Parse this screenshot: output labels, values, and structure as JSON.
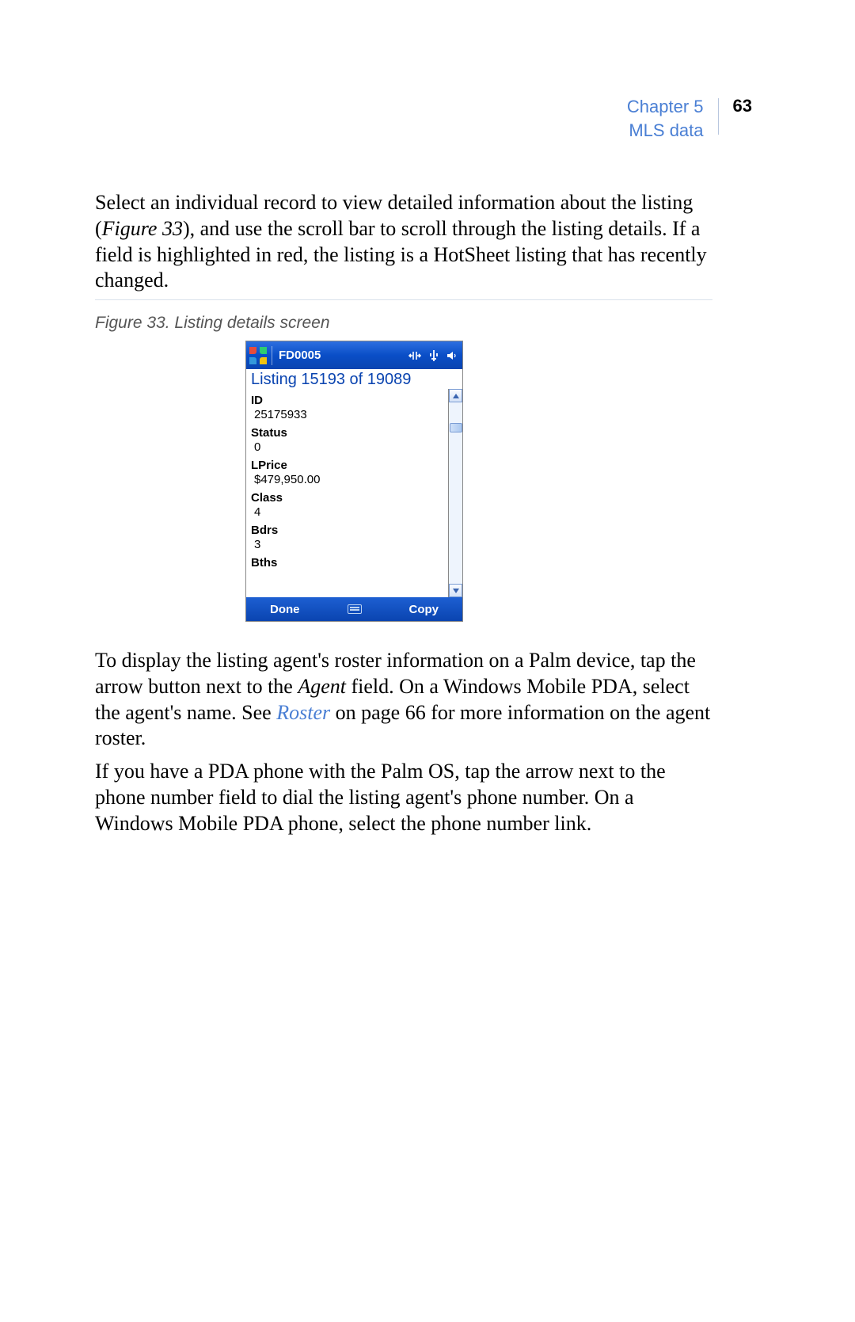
{
  "header": {
    "chapter": "Chapter 5",
    "section": "MLS data",
    "page": "63"
  },
  "paragraphs": {
    "p1_a": "Select an individual record to view detailed information about the listing (",
    "p1_fig": "Figure 33",
    "p1_b": "), and use the scroll bar to scroll through the listing details.  If a field is highlighted in red, the listing is a HotSheet listing that has recently changed.",
    "p2_a": "To display the listing agent's roster information on a Palm device, tap the arrow button next to the ",
    "p2_agent": "Agent",
    "p2_b": " field.  On a Windows Mobile PDA, select the agent's name.  See ",
    "p2_link": "Roster",
    "p2_c": " on page 66 for more information on the agent roster.",
    "p3": "If you have a PDA phone with the Palm OS, tap the arrow next to the phone number field to dial the listing agent's phone number.  On a Windows Mobile PDA phone, select the phone number link."
  },
  "figure": {
    "caption": "Figure 33.  Listing details screen"
  },
  "pda": {
    "title": "FD0005",
    "listing_header": "Listing 15193 of 19089",
    "fields": [
      {
        "label": "ID",
        "value": "25175933"
      },
      {
        "label": "Status",
        "value": "0"
      },
      {
        "label": "LPrice",
        "value": "$479,950.00"
      },
      {
        "label": "Class",
        "value": "4"
      },
      {
        "label": "Bdrs",
        "value": "3"
      },
      {
        "label": "Bths",
        "value": ""
      }
    ],
    "buttons": {
      "done": "Done",
      "copy": "Copy"
    }
  }
}
